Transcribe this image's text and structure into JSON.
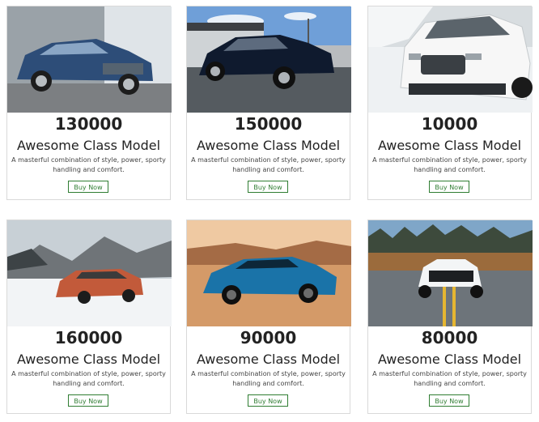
{
  "cards": [
    {
      "price": "130000",
      "title": "Awesome Class Model",
      "description": "A masterful combination of style, power, sporty handling and comfort.",
      "button": "Buy Now",
      "image": "blue-coupe-image"
    },
    {
      "price": "150000",
      "title": "Awesome Class Model",
      "description": "A masterful combination of style, power, sporty handling and comfort.",
      "button": "Buy Now",
      "image": "dark-sedan-image"
    },
    {
      "price": "10000",
      "title": "Awesome Class Model",
      "description": "A masterful combination of style, power, sporty handling and comfort.",
      "button": "Buy Now",
      "image": "white-suv-image"
    },
    {
      "price": "160000",
      "title": "Awesome Class Model",
      "description": "A masterful combination of style, power, sporty handling and comfort.",
      "button": "Buy Now",
      "image": "orange-wagon-image"
    },
    {
      "price": "90000",
      "title": "Awesome Class Model",
      "description": "A masterful combination of style, power, sporty handling and comfort.",
      "button": "Buy Now",
      "image": "blue-sportscar-image"
    },
    {
      "price": "80000",
      "title": "Awesome Class Model",
      "description": "A masterful combination of style, power, sporty handling and comfort.",
      "button": "Buy Now",
      "image": "white-supercar-image"
    }
  ]
}
